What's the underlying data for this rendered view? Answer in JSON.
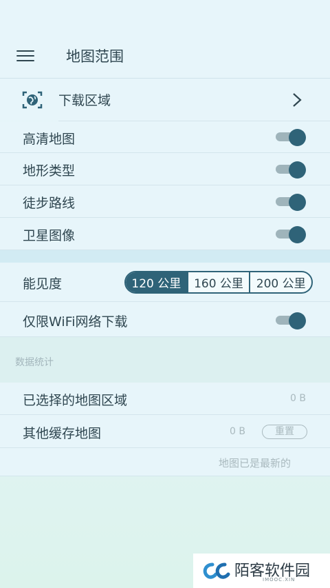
{
  "header": {
    "title": "地图范围",
    "menu_icon": "hamburger-menu-icon"
  },
  "download_area": {
    "label": "下载区域",
    "icon": "globe-scan-icon",
    "chevron": "chevron-right-icon"
  },
  "toggles": [
    {
      "label": "高清地图",
      "on": true
    },
    {
      "label": "地形类型",
      "on": true
    },
    {
      "label": "徒步路线",
      "on": true
    },
    {
      "label": "卫星图像",
      "on": true
    }
  ],
  "visibility": {
    "label": "能见度",
    "options": [
      "120 公里",
      "160 公里",
      "200 公里"
    ],
    "selected": "120 公里"
  },
  "wifi_only": {
    "label": "仅限WiFi网络下载",
    "on": true
  },
  "stats": {
    "section_title": "数据统计",
    "selected_areas": {
      "label": "已选择的地图区域",
      "value": "0 B"
    },
    "other_cache": {
      "label": "其他缓存地图",
      "value": "0 B",
      "reset_label": "重置"
    },
    "status": "地图已是最新的"
  },
  "watermark": {
    "text": "陌客软件园",
    "sub": "IMOOC.XIN"
  },
  "colors": {
    "accent": "#2f6378",
    "background": "#e7f5fa",
    "muted": "#a9b9be"
  }
}
